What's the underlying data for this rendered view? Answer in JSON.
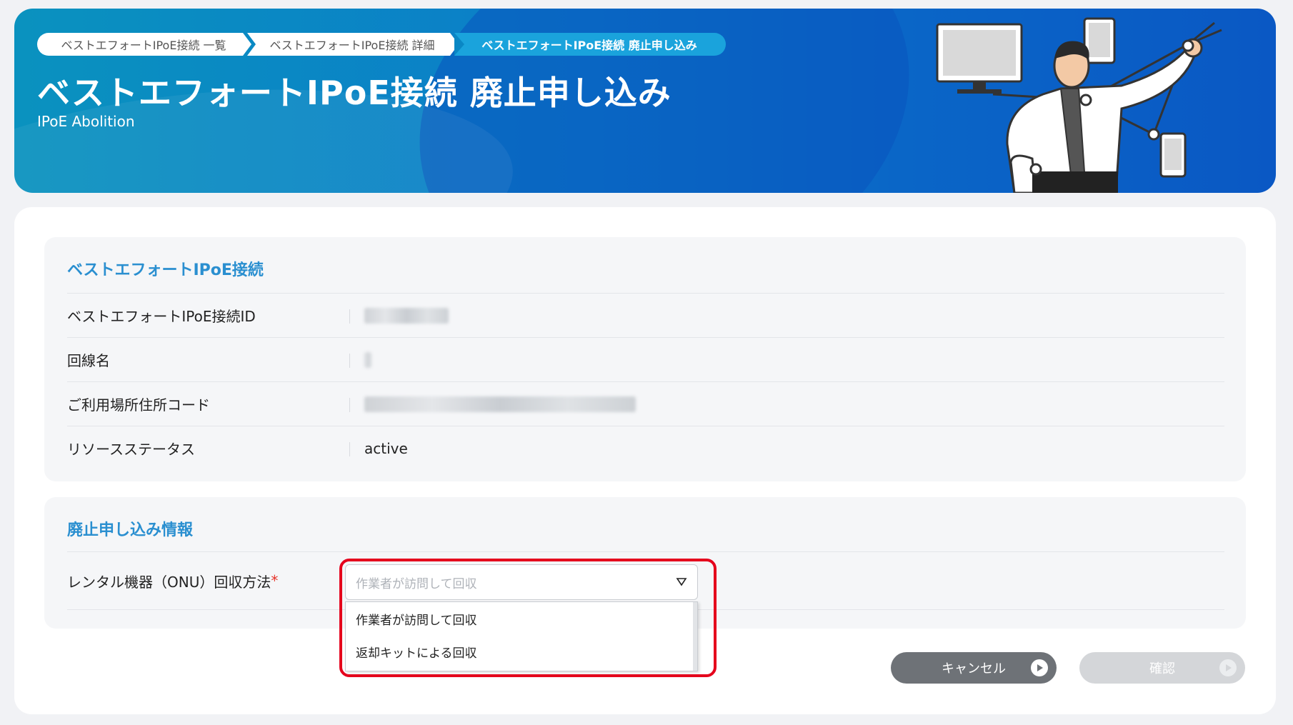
{
  "breadcrumb": [
    "ベストエフォートIPoE接続 一覧",
    "ベストエフォートIPoE接続 詳細",
    "ベストエフォートIPoE接続 廃止申し込み"
  ],
  "header": {
    "title": "ベストエフォートIPoE接続 廃止申し込み",
    "subtitle": "IPoE Abolition"
  },
  "section1": {
    "title": "ベストエフォートIPoE接続",
    "rows": [
      {
        "label": "ベストエフォートIPoE接続ID",
        "value": ""
      },
      {
        "label": "回線名",
        "value": ""
      },
      {
        "label": "ご利用場所住所コード",
        "value": ""
      },
      {
        "label": "リソースステータス",
        "value": "active"
      }
    ]
  },
  "section2": {
    "title": "廃止申し込み情報",
    "field_label": "レンタル機器（ONU）回収方法",
    "required_mark": "*",
    "select_placeholder": "作業者が訪問して回収",
    "options": [
      "作業者が訪問して回収",
      "返却キットによる回収"
    ]
  },
  "buttons": {
    "cancel": "キャンセル",
    "confirm": "確認"
  },
  "colors": {
    "accent": "#2a8fd0",
    "highlight": "#e5001c",
    "cancel_button": "#6e7277",
    "confirm_disabled": "#d4d6d9"
  }
}
